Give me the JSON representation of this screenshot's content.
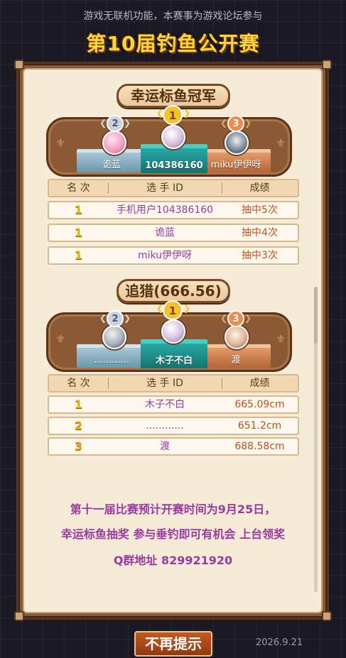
{
  "header": {
    "notice": "游戏无联机功能，本赛事为游戏论坛参与",
    "title": "第10届钓鱼公开赛"
  },
  "section1": {
    "title": "幸运标鱼冠军",
    "podium": {
      "first": "104386160",
      "second": "诡蓝",
      "third": "miku伊伊呀"
    },
    "medals": {
      "first": "1",
      "second": "2",
      "third": "3"
    },
    "columns": {
      "rank": "名 次",
      "player": "选 手 ID",
      "score": "成绩"
    },
    "rows": [
      {
        "rank": "1",
        "player": "手机用户104386160",
        "score": "抽中5次"
      },
      {
        "rank": "1",
        "player": "诡蓝",
        "score": "抽中4次"
      },
      {
        "rank": "1",
        "player": "miku伊伊呀",
        "score": "抽中3次"
      }
    ]
  },
  "section2": {
    "title": "追猎(666.56)",
    "podium": {
      "first": "木子不白",
      "second": "............",
      "third": "渡"
    },
    "medals": {
      "first": "1",
      "second": "2",
      "third": "3"
    },
    "columns": {
      "rank": "名 次",
      "player": "选 手 ID",
      "score": "成绩"
    },
    "rows": [
      {
        "rank": "1",
        "player": "木子不白",
        "score": "665.09cm"
      },
      {
        "rank": "2",
        "player": "............",
        "score": "651.2cm"
      },
      {
        "rank": "3",
        "player": "渡",
        "score": "688.58cm"
      }
    ]
  },
  "footer": {
    "line1": "第十一届比赛预计开赛时间为9月25日，",
    "line2": "幸运标鱼抽奖 参与垂钓即可有机会 上台领奖",
    "line3": "Q群地址 829921920"
  },
  "dismiss_button": "不再提示",
  "date": "2026.9.21",
  "colors": {
    "title_gold": "#ffd33a",
    "name_purple": "#9a3aa0",
    "score_orange": "#c0521c",
    "frame_brown": "#8a5a36"
  }
}
